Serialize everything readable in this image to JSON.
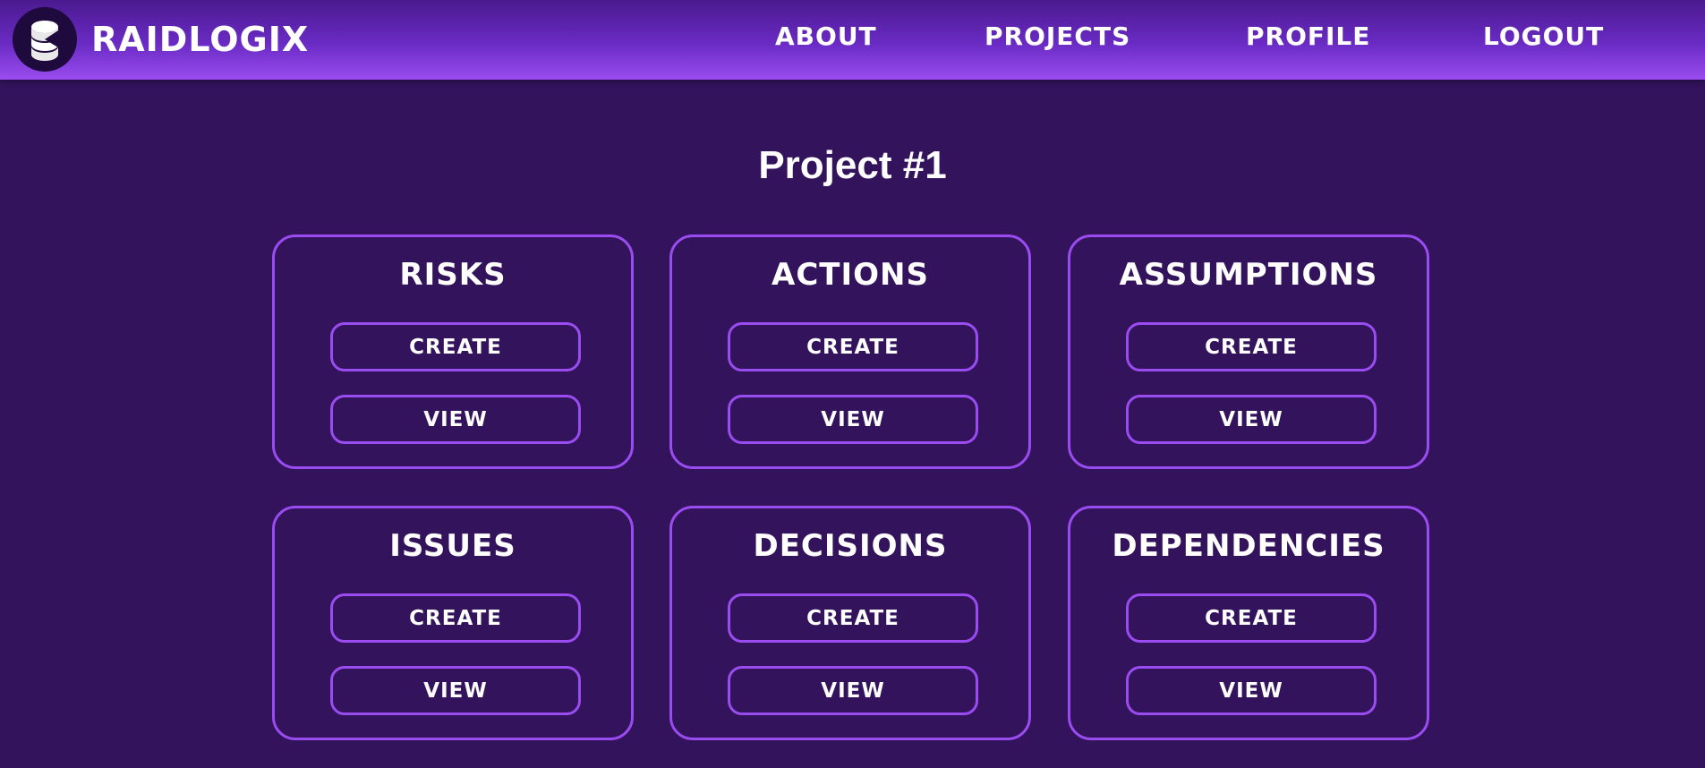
{
  "brand": {
    "name": "RAIDLOGIX",
    "icon": "database-coin-icon"
  },
  "nav": {
    "about": "ABOUT",
    "projects": "PROJECTS",
    "profile": "PROFILE",
    "logout": "LOGOUT"
  },
  "page": {
    "title": "Project #1"
  },
  "cards": [
    {
      "title": "RISKS",
      "create": "CREATE",
      "view": "VIEW"
    },
    {
      "title": "ACTIONS",
      "create": "CREATE",
      "view": "VIEW"
    },
    {
      "title": "ASSUMPTIONS",
      "create": "CREATE",
      "view": "VIEW"
    },
    {
      "title": "ISSUES",
      "create": "CREATE",
      "view": "VIEW"
    },
    {
      "title": "DECISIONS",
      "create": "CREATE",
      "view": "VIEW"
    },
    {
      "title": "DEPENDENCIES",
      "create": "CREATE",
      "view": "VIEW"
    }
  ],
  "colors": {
    "background": "#32135c",
    "accent": "#9a4cf0",
    "header_top": "#4a1a8f",
    "header_bottom": "#9a4cf0",
    "text": "#ffffff"
  }
}
